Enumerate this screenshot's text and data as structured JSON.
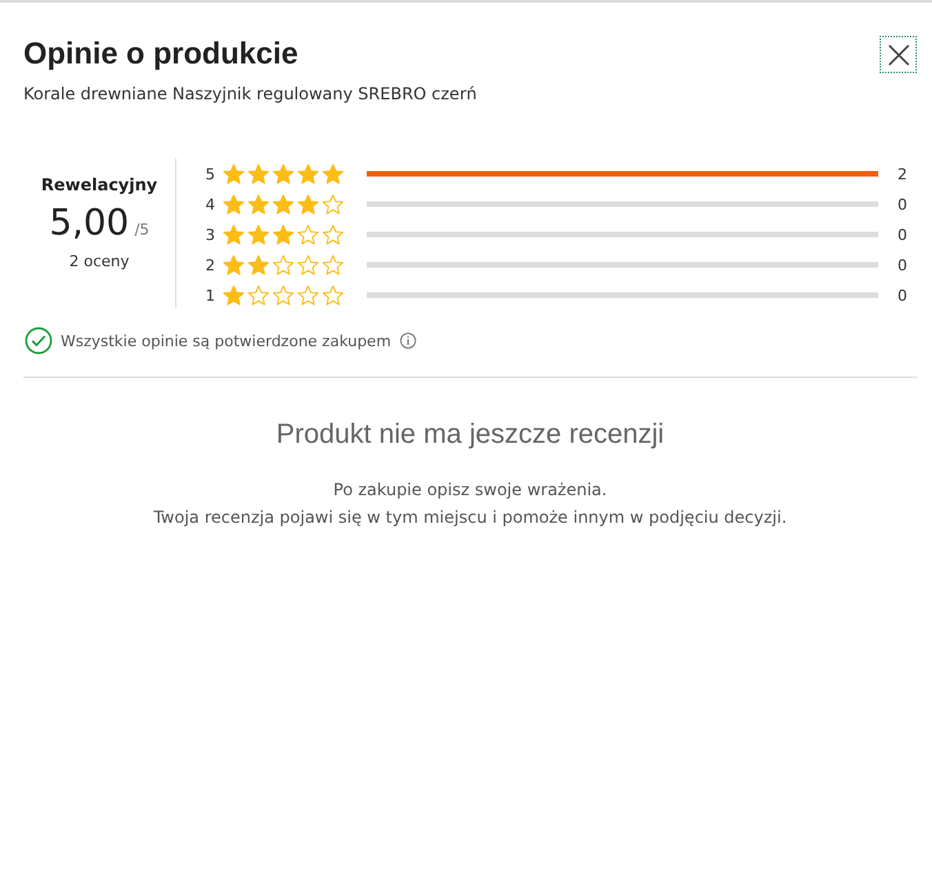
{
  "dialog": {
    "title": "Opinie o produkcie",
    "subtitle": "Korale drewniane Naszyjnik regulowany SREBRO czerń"
  },
  "summary": {
    "verdict": "Rewelacyjny",
    "score": "5,00",
    "scale": "/5",
    "count": "2 oceny"
  },
  "distribution": [
    {
      "label": "5",
      "stars": 5,
      "level": 1,
      "count": "2"
    },
    {
      "label": "4",
      "stars": 4,
      "level": 0,
      "count": "0"
    },
    {
      "label": "3",
      "stars": 3,
      "level": 0,
      "count": "0"
    },
    {
      "label": "2",
      "stars": 2,
      "level": 0,
      "count": "0"
    },
    {
      "label": "1",
      "stars": 1,
      "level": 0,
      "count": "0"
    }
  ],
  "verified_note": "Wszystkie opinie są potwierdzone zakupem",
  "empty_state": {
    "title": "Produkt nie ma jeszcze recenzji",
    "lines": [
      "Po zakupie opisz swoje wrażenia.",
      "Twoja recenzja pojawi się w tym miejscu i pomoże innym w podjęciu decyzji."
    ]
  }
}
